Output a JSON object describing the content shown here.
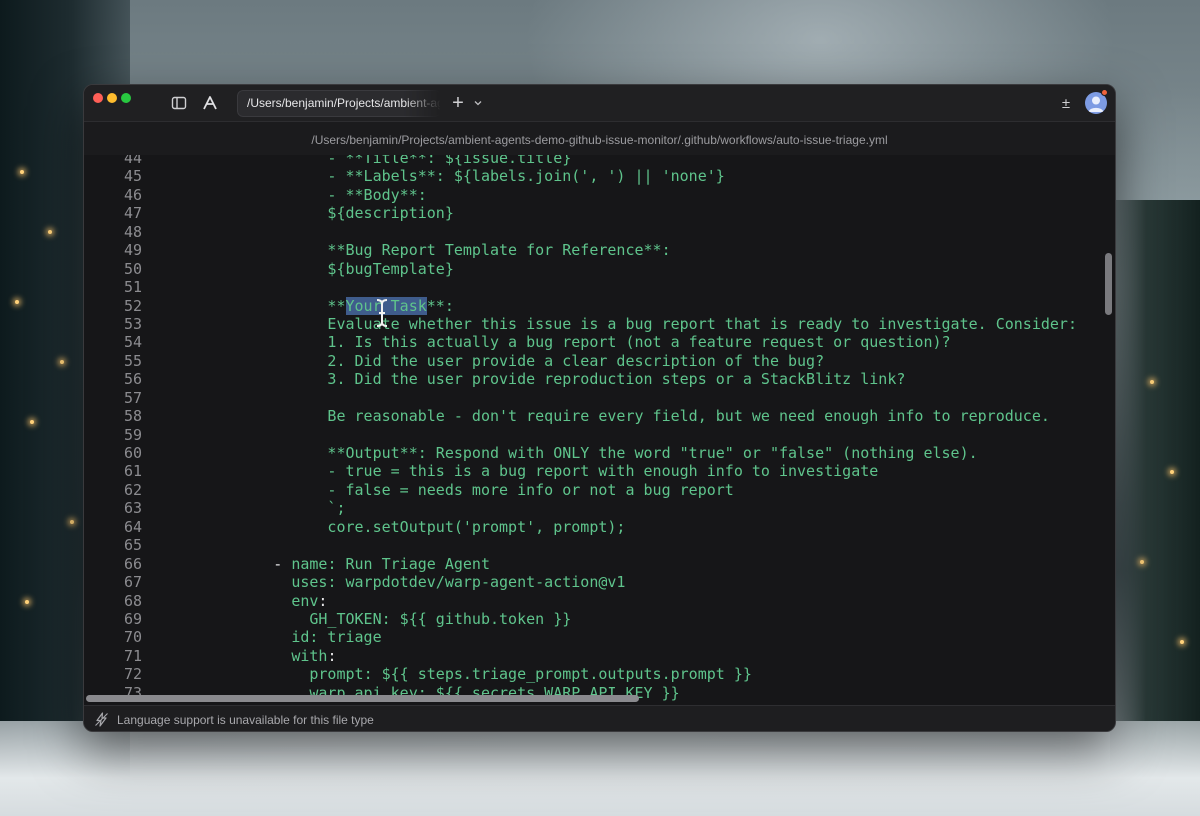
{
  "window": {
    "tab_title": "/Users/benjamin/Projects/ambient-agents-demo-github-issue-monitor",
    "file_path": "/Users/benjamin/Projects/ambient-agents-demo-github-issue-monitor/.github/workflows/auto-issue-triage.yml"
  },
  "icons": {
    "sidebar": "sidebar-toggle-icon",
    "warp": "warp-logo-icon",
    "new_tab": "plus-icon",
    "tab_menu": "chevron-down-icon",
    "sync": "plus-minus-icon",
    "status": "lightning-bolt-icon"
  },
  "colors": {
    "string_green": "#5fc48c",
    "selection": "#3f5c8c",
    "avatar_badge": "#f0643c"
  },
  "editor": {
    "selected_text": "Your Task",
    "lines": [
      {
        "n": "44",
        "segments": [
          {
            "t": "              - **Title**: ${issue.title}",
            "c": "str"
          }
        ]
      },
      {
        "n": "45",
        "segments": [
          {
            "t": "              - **Labels**: ${labels.join(', ') || 'none'}",
            "c": "str"
          }
        ]
      },
      {
        "n": "46",
        "segments": [
          {
            "t": "              - **Body**:",
            "c": "str"
          }
        ]
      },
      {
        "n": "47",
        "segments": [
          {
            "t": "              ${description}",
            "c": "str"
          }
        ]
      },
      {
        "n": "48",
        "segments": []
      },
      {
        "n": "49",
        "segments": [
          {
            "t": "              **Bug Report Template for Reference**:",
            "c": "str"
          }
        ]
      },
      {
        "n": "50",
        "segments": [
          {
            "t": "              ${bugTemplate}",
            "c": "str"
          }
        ]
      },
      {
        "n": "51",
        "segments": []
      },
      {
        "n": "52",
        "segments": [
          {
            "t": "              **",
            "c": "str"
          },
          {
            "t": "Your Task",
            "c": "hl"
          },
          {
            "t": "**:",
            "c": "str"
          }
        ]
      },
      {
        "n": "53",
        "segments": [
          {
            "t": "              Evaluate whether this issue is a bug report that is ready to investigate. Consider:",
            "c": "str"
          }
        ]
      },
      {
        "n": "54",
        "segments": [
          {
            "t": "              1. Is this actually a bug report (not a feature request or question)?",
            "c": "str"
          }
        ]
      },
      {
        "n": "55",
        "segments": [
          {
            "t": "              2. Did the user provide a clear description of the bug?",
            "c": "str"
          }
        ]
      },
      {
        "n": "56",
        "segments": [
          {
            "t": "              3. Did the user provide reproduction steps or a StackBlitz link?",
            "c": "str"
          }
        ]
      },
      {
        "n": "57",
        "segments": []
      },
      {
        "n": "58",
        "segments": [
          {
            "t": "              Be reasonable - don't require every field, but we need enough info to reproduce.",
            "c": "str"
          }
        ]
      },
      {
        "n": "59",
        "segments": []
      },
      {
        "n": "60",
        "segments": [
          {
            "t": "              **Output**: Respond with ONLY the word \"true\" or \"false\" (nothing else).",
            "c": "str"
          }
        ]
      },
      {
        "n": "61",
        "segments": [
          {
            "t": "              - true = this is a bug report with enough info to investigate",
            "c": "str"
          }
        ]
      },
      {
        "n": "62",
        "segments": [
          {
            "t": "              - false = needs more info or not a bug report",
            "c": "str"
          }
        ]
      },
      {
        "n": "63",
        "segments": [
          {
            "t": "              `;",
            "c": "str"
          }
        ]
      },
      {
        "n": "64",
        "segments": [
          {
            "t": "              core.setOutput('prompt', prompt);",
            "c": "str"
          }
        ]
      },
      {
        "n": "65",
        "segments": []
      },
      {
        "n": "66",
        "segments": [
          {
            "t": "        - ",
            "c": "plain"
          },
          {
            "t": "name",
            "c": "key"
          },
          {
            "t": ": Run Triage Agent",
            "c": "str"
          }
        ]
      },
      {
        "n": "67",
        "segments": [
          {
            "t": "          ",
            "c": "plain"
          },
          {
            "t": "uses",
            "c": "key"
          },
          {
            "t": ": warpdotdev/warp-agent-action@v1",
            "c": "str"
          }
        ]
      },
      {
        "n": "68",
        "segments": [
          {
            "t": "          ",
            "c": "plain"
          },
          {
            "t": "env",
            "c": "key"
          },
          {
            "t": ":",
            "c": "plain"
          }
        ]
      },
      {
        "n": "69",
        "segments": [
          {
            "t": "            ",
            "c": "plain"
          },
          {
            "t": "GH_TOKEN",
            "c": "key"
          },
          {
            "t": ": ${{ github.token }}",
            "c": "str"
          }
        ]
      },
      {
        "n": "70",
        "segments": [
          {
            "t": "          ",
            "c": "plain"
          },
          {
            "t": "id",
            "c": "key"
          },
          {
            "t": ": triage",
            "c": "str"
          }
        ]
      },
      {
        "n": "71",
        "segments": [
          {
            "t": "          ",
            "c": "plain"
          },
          {
            "t": "with",
            "c": "key"
          },
          {
            "t": ":",
            "c": "plain"
          }
        ]
      },
      {
        "n": "72",
        "segments": [
          {
            "t": "            ",
            "c": "plain"
          },
          {
            "t": "prompt",
            "c": "key"
          },
          {
            "t": ": ${{ steps.triage_prompt.outputs.prompt }}",
            "c": "str"
          }
        ]
      },
      {
        "n": "73",
        "segments": [
          {
            "t": "            ",
            "c": "plain"
          },
          {
            "t": "warp_api_key",
            "c": "key"
          },
          {
            "t": ": ${{ secrets.WARP_API_KEY }}",
            "c": "str"
          }
        ]
      }
    ]
  },
  "status_bar": {
    "message": "Language support is unavailable for this file type"
  }
}
